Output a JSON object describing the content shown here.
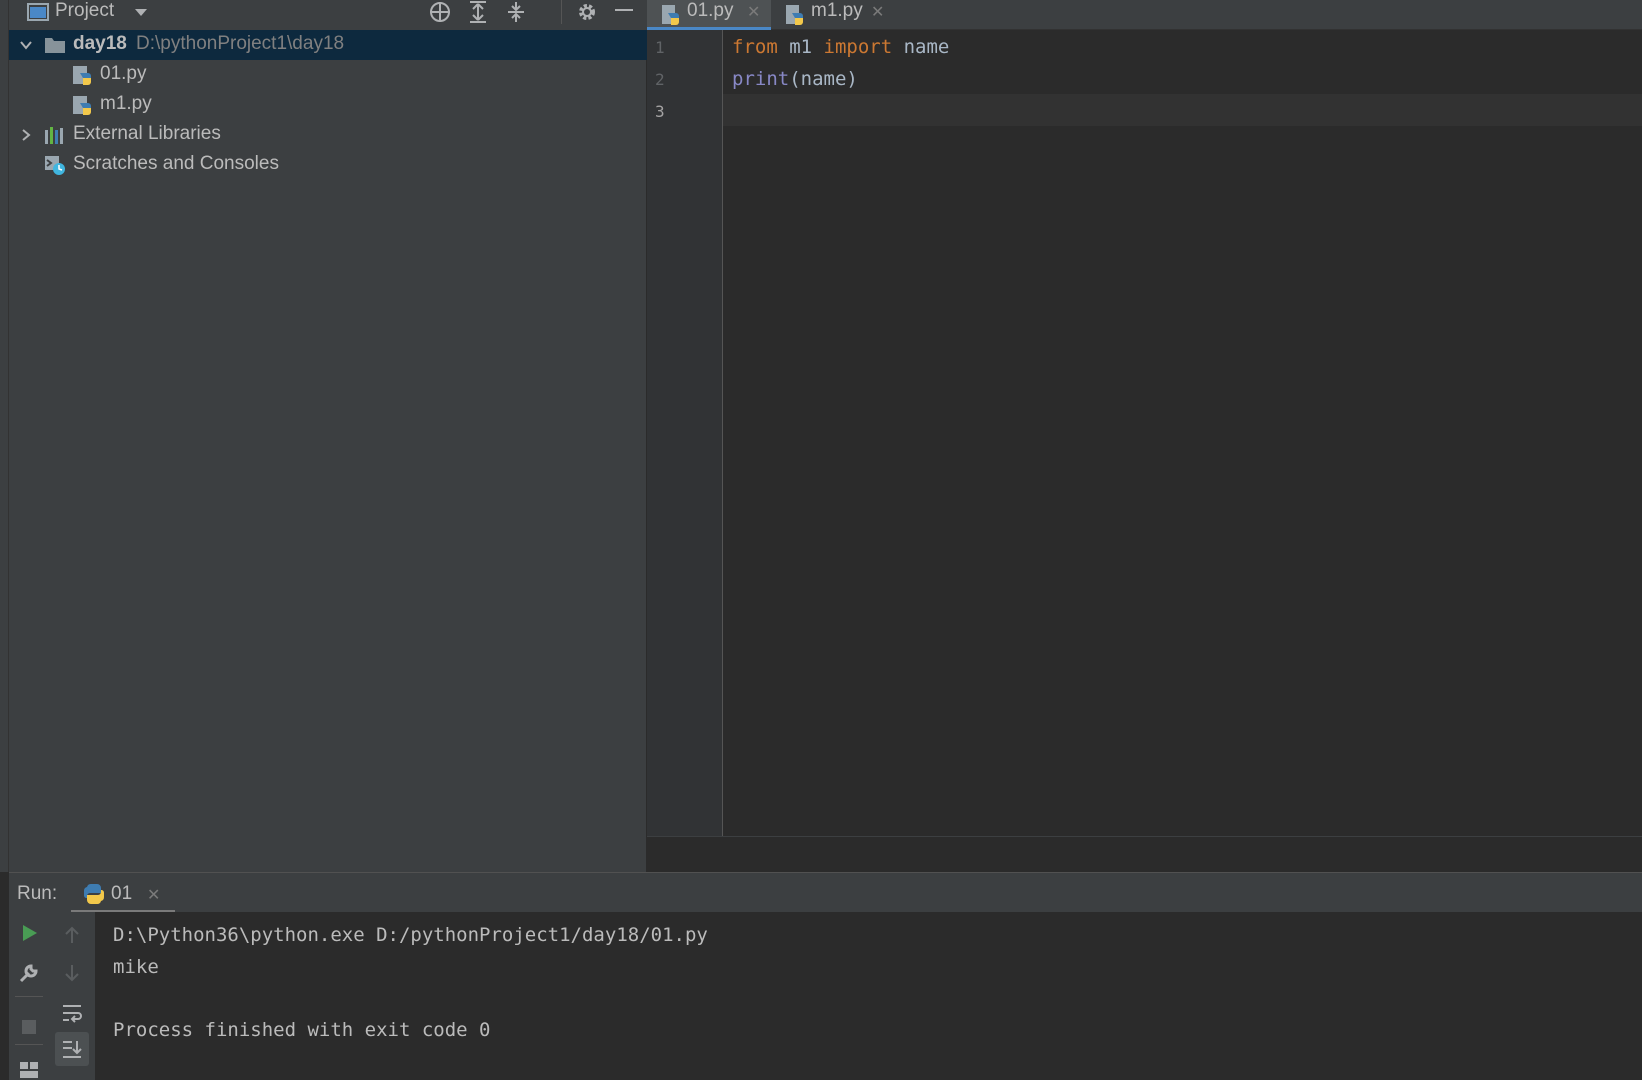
{
  "project": {
    "title": "Project",
    "root": {
      "name": "day18",
      "path": "D:\\pythonProject1\\day18"
    },
    "files": [
      "01.py",
      "m1.py"
    ],
    "external_libraries": "External Libraries",
    "scratches": "Scratches and Consoles"
  },
  "editor": {
    "tabs": [
      {
        "label": "01.py",
        "active": true
      },
      {
        "label": "m1.py",
        "active": false
      }
    ],
    "line_numbers": [
      "1",
      "2",
      "3"
    ],
    "code": {
      "line1": {
        "kw1": "from",
        "module": " m1 ",
        "kw2": "import",
        "rest": " name"
      },
      "line2": {
        "builtin": "print",
        "rest": "(name)"
      }
    }
  },
  "run": {
    "label": "Run:",
    "tab_label": "01",
    "output": [
      "D:\\Python36\\python.exe D:/pythonProject1/day18/01.py",
      "mike",
      "",
      "Process finished with exit code 0"
    ]
  },
  "colors": {
    "keyword": "#cc7832",
    "builtin": "#8888c6",
    "selection": "#0d293e",
    "accent": "#4a88c7",
    "run_green": "#499c54"
  }
}
